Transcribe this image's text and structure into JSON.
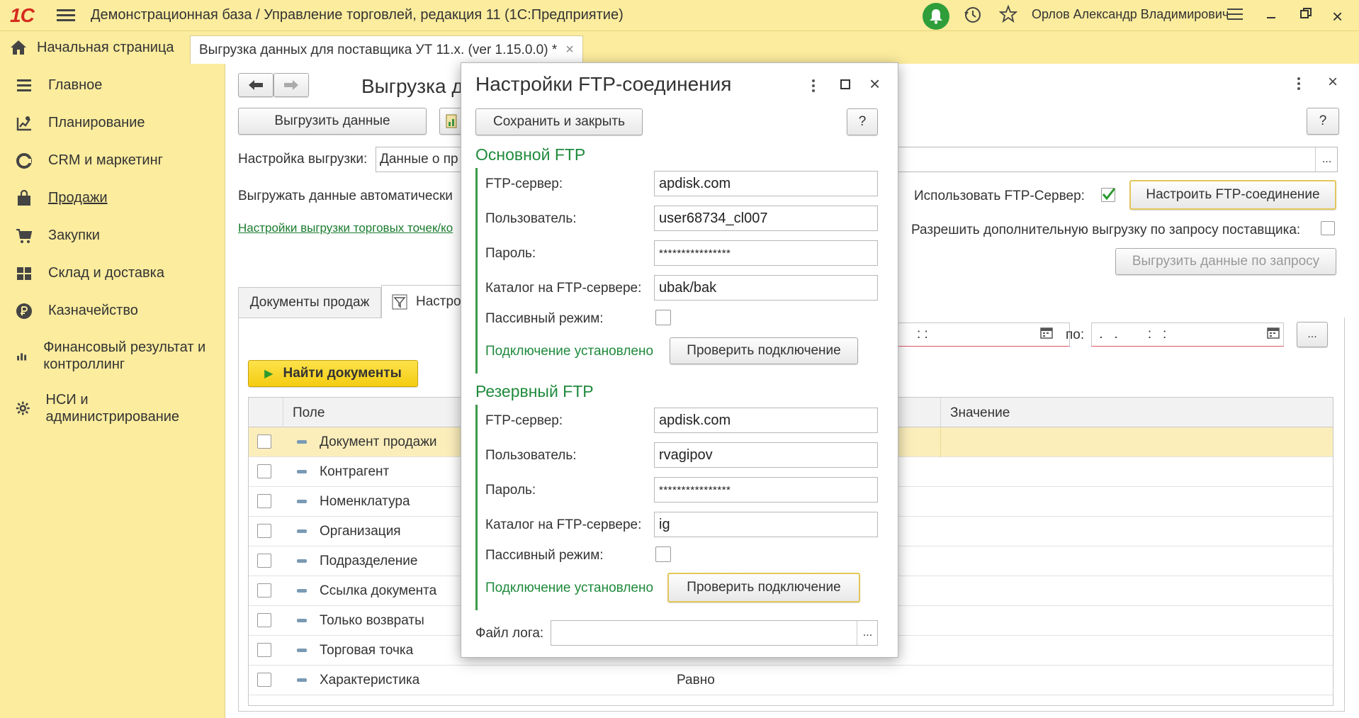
{
  "titlebar": {
    "logo": "1С",
    "title": "Демонстрационная база / Управление торговлей, редакция 11  (1С:Предприятие)",
    "user": "Орлов Александр Владимирович"
  },
  "tabs": {
    "home": "Начальная страница",
    "doc": "Выгрузка данных для поставщика УТ 11.х. (ver 1.15.0.0) *",
    "doc_close": "×"
  },
  "sidebar": {
    "items": [
      {
        "label": "Главное",
        "icon": "menu-lines-icon"
      },
      {
        "label": "Планирование",
        "icon": "planning-icon"
      },
      {
        "label": "CRM и маркетинг",
        "icon": "crm-icon"
      },
      {
        "label": "Продажи",
        "icon": "sales-bag-icon"
      },
      {
        "label": "Закупки",
        "icon": "cart-icon"
      },
      {
        "label": "Склад и доставка",
        "icon": "warehouse-icon"
      },
      {
        "label": "Казначейство",
        "icon": "ruble-icon"
      },
      {
        "label": "Финансовый результат и контроллинг",
        "icon": "bar-chart-icon"
      },
      {
        "label": "НСИ и администрирование",
        "icon": "gear-icon"
      }
    ]
  },
  "main": {
    "title": "Выгрузка д",
    "export_button": "Выгрузить данные",
    "help": "?",
    "setting_label": "Настройка выгрузки:",
    "setting_value": "Данные о пр",
    "ellipsis": "...",
    "auto_label": "Выгружать данные автоматически",
    "use_ftp_label": "Использовать FTP-Сервер:",
    "use_ftp_check": "✓",
    "configure_ftp_button": "Настроить FTP-соединение",
    "stores_link": "Настройки выгрузки торговых точек/ко",
    "allow_label": "Разрешить дополнительную выгрузку по запросу поставщика:",
    "export_request_button": "Выгрузить данные по запросу",
    "tab_sales": "Документы продаж",
    "tab_settings": "Настро",
    "date_from": ":   :",
    "to_label": "по:",
    "date_to": " .   .        :   :",
    "find_button": "Найти документы",
    "grid": {
      "col_field": "Поле",
      "col_value": "Значение",
      "rows": [
        {
          "name": "Документ продажи",
          "cmp": ""
        },
        {
          "name": "Контрагент",
          "cmp": ""
        },
        {
          "name": "Номенклатура",
          "cmp": ""
        },
        {
          "name": "Организация",
          "cmp": ""
        },
        {
          "name": "Подразделение",
          "cmp": ""
        },
        {
          "name": "Ссылка документа",
          "cmp": ""
        },
        {
          "name": "Только возвраты",
          "cmp": ""
        },
        {
          "name": "Торговая точка",
          "cmp": ""
        },
        {
          "name": "Характеристика",
          "cmp": "Равно"
        }
      ]
    }
  },
  "dialog": {
    "title": "Настройки FTP-соединения",
    "save_close": "Сохранить и закрыть",
    "help": "?",
    "primary": {
      "title": "Основной FTP",
      "server_label": "FTP-сервер:",
      "server": "apdisk.com",
      "user_label": "Пользователь:",
      "user": "user68734_cl007",
      "pass_label": "Пароль:",
      "pass": "****************",
      "dir_label": "Каталог на FTP-сервере:",
      "dir": "ubak/bak",
      "passive_label": "Пассивный режим:",
      "status": "Подключение установлено",
      "check_button": "Проверить подключение"
    },
    "backup": {
      "title": "Резервный FTP",
      "server_label": "FTP-сервер:",
      "server": "apdisk.com",
      "user_label": "Пользователь:",
      "user": "rvagipov",
      "pass_label": "Пароль:",
      "pass": "****************",
      "dir_label": "Каталог на FTP-сервере:",
      "dir": "ig",
      "passive_label": "Пассивный режим:",
      "status": "Подключение установлено",
      "check_button": "Проверить подключение"
    },
    "log_label": "Файл лога:",
    "log_btn": "..."
  }
}
